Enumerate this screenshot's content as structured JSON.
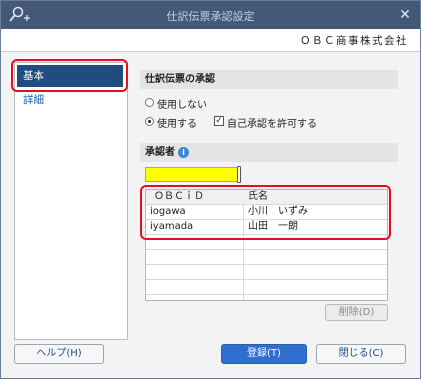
{
  "window": {
    "title": "仕訳伝票承認設定",
    "close_glyph": "✕",
    "company": "ＯＢＣ商事株式会社"
  },
  "sidebar": {
    "items": [
      {
        "label": "基本"
      },
      {
        "label": "詳細"
      }
    ]
  },
  "approval": {
    "section_title": "仕訳伝票の承認",
    "options": [
      {
        "label": "使用しない",
        "selected": false
      },
      {
        "label": "使用する",
        "selected": true
      }
    ],
    "self_approve_label": "自己承認を許可する",
    "self_approve_checked": true
  },
  "approvers": {
    "section_title": "承認者",
    "info_glyph": "i",
    "input_value": "",
    "columns": [
      "ＯＢＣｉＤ",
      "氏名"
    ],
    "rows": [
      [
        "iogawa",
        "小川　いずみ"
      ],
      [
        "iyamada",
        "山田　一朗"
      ]
    ],
    "delete_label": "削除(D)"
  },
  "footer": {
    "help_label": "ヘルプ(H)",
    "register_label": "登録(T)",
    "close_label": "閉じる(C)"
  },
  "colors": {
    "titlebar": "#44597a",
    "nav_selected": "#1f4e7e",
    "highlight": "#e0101e",
    "input_highlight": "#ffff00",
    "primary_button": "#2f6fd0"
  },
  "icons": {
    "app_icon": "search-plus-icon",
    "info": "info-icon",
    "close": "close-icon"
  }
}
